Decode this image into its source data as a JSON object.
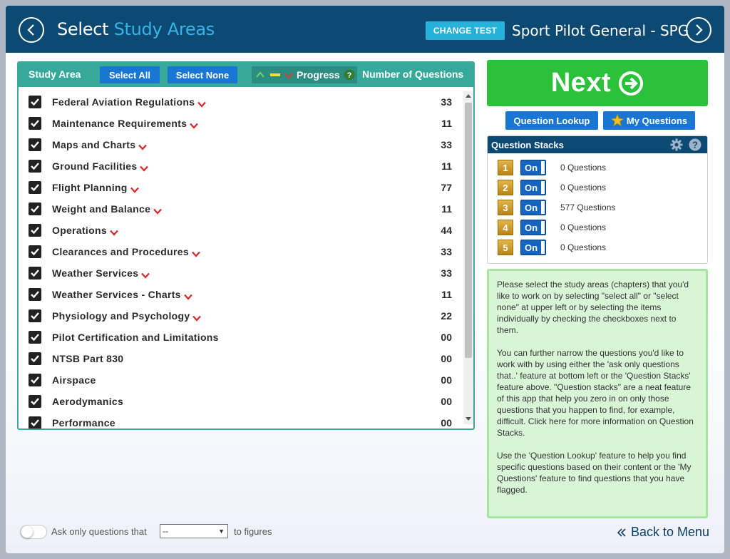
{
  "header": {
    "title_prefix": "Select",
    "title_accent": "Study Areas",
    "change_test_label": "CHANGE TEST",
    "test_name": "Sport Pilot General - SPG"
  },
  "study_panel": {
    "col_study_area": "Study Area",
    "select_all": "Select All",
    "select_none": "Select None",
    "col_progress": "Progress",
    "col_number": "Number of Questions",
    "items": [
      {
        "label": "Federal Aviation Regulations",
        "count": "33",
        "checked": true,
        "chevron": true
      },
      {
        "label": "Maintenance Requirements",
        "count": "11",
        "checked": true,
        "chevron": true
      },
      {
        "label": "Maps and Charts",
        "count": "33",
        "checked": true,
        "chevron": true
      },
      {
        "label": "Ground Facilities",
        "count": "11",
        "checked": true,
        "chevron": true
      },
      {
        "label": "Flight Planning",
        "count": "77",
        "checked": true,
        "chevron": true
      },
      {
        "label": "Weight and Balance",
        "count": "11",
        "checked": true,
        "chevron": true
      },
      {
        "label": "Operations",
        "count": "44",
        "checked": true,
        "chevron": true
      },
      {
        "label": "Clearances and Procedures",
        "count": "33",
        "checked": true,
        "chevron": true
      },
      {
        "label": "Weather Services",
        "count": "33",
        "checked": true,
        "chevron": true
      },
      {
        "label": "Weather Services - Charts",
        "count": "11",
        "checked": true,
        "chevron": true
      },
      {
        "label": "Physiology and Psychology",
        "count": "22",
        "checked": true,
        "chevron": true
      },
      {
        "label": "Pilot Certification and Limitations",
        "count": "00",
        "checked": true,
        "chevron": false
      },
      {
        "label": "NTSB Part 830",
        "count": "00",
        "checked": true,
        "chevron": false
      },
      {
        "label": "Airspace",
        "count": "00",
        "checked": true,
        "chevron": false
      },
      {
        "label": "Aerodymanics",
        "count": "00",
        "checked": true,
        "chevron": false
      },
      {
        "label": "Performance",
        "count": "00",
        "checked": true,
        "chevron": false
      }
    ]
  },
  "next_label": "Next",
  "question_lookup_label": "Question Lookup",
  "my_questions_label": "My Questions",
  "question_stacks": {
    "title": "Question Stacks",
    "stacks": [
      {
        "num": "1",
        "toggle": "On",
        "count": "0 Questions"
      },
      {
        "num": "2",
        "toggle": "On",
        "count": "0 Questions"
      },
      {
        "num": "3",
        "toggle": "On",
        "count": "577 Questions"
      },
      {
        "num": "4",
        "toggle": "On",
        "count": "0 Questions"
      },
      {
        "num": "5",
        "toggle": "On",
        "count": "0 Questions"
      }
    ]
  },
  "info": {
    "p1": "Please select the study areas (chapters) that you'd like to work on by selecting \"select all\" or \"select none\" at upper left or by selecting the items individually by checking the checkboxes next to them.",
    "p2": "You can further narrow the questions you'd like to work with by using either the 'ask only questions that..' feature at bottom left or the 'Question Stacks' feature above. \"Question stacks\" are a neat feature of this app that help you zero in on only those questions that you happen to find, for example, difficult. Click here for more information on Question Stacks.",
    "p3": "Use the 'Question Lookup' feature to help you find specific questions based on their content or the 'My Questions' feature to find questions that you have flagged."
  },
  "footer": {
    "ask_label": "Ask only questions that",
    "select_value": "--",
    "suffix": "to figures",
    "back_label": "Back to Menu"
  },
  "colors": {
    "header_bg": "#0d4a73",
    "accent": "#36b3e8",
    "teal": "#37a99a",
    "next_green": "#2cc13a",
    "button_blue": "#1976d2",
    "chevron_red": "#d32f2f"
  },
  "icons": [
    "back-arrow-icon",
    "forward-arrow-icon",
    "checkbox-checked-icon",
    "chevron-down-icon",
    "progress-up-icon",
    "progress-mid-icon",
    "progress-down-icon",
    "help-icon",
    "arrow-circle-right-icon",
    "star-icon",
    "gear-icon",
    "double-chevron-left-icon"
  ]
}
